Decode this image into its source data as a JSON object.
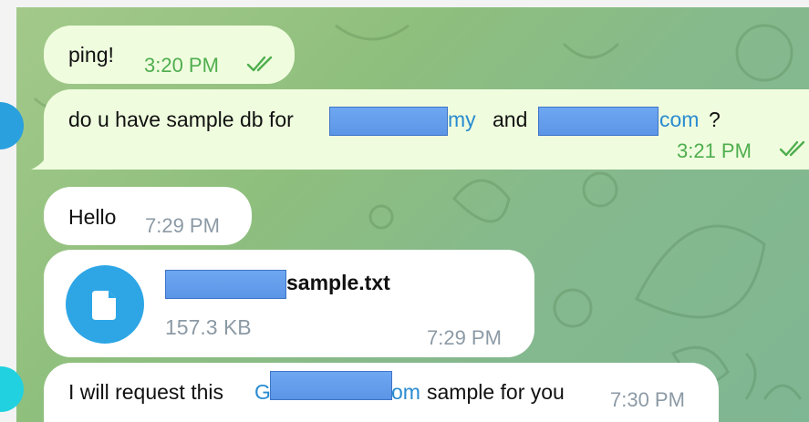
{
  "messages": [
    {
      "text": "ping!",
      "time": "3:20 PM"
    },
    {
      "text_before": "do u have sample db for",
      "link1": "my",
      "middle": "and",
      "link2": "com",
      "after": "?",
      "time": "3:21 PM"
    },
    {
      "text": "Hello",
      "time": "7:29 PM"
    },
    {
      "file_name": "sample.txt",
      "file_size": "157.3 KB",
      "time": "7:29 PM"
    },
    {
      "text_before": "I will request this",
      "link_start": "G",
      "link_end": "om",
      "after": "sample for you",
      "time": "7:30 PM"
    }
  ],
  "colors": {
    "outgoing_bubble": "#effdde",
    "incoming_bubble": "#ffffff",
    "outgoing_time": "#4fae4e",
    "link": "#2a8bd0",
    "file_icon_bg": "#2ea6e6"
  },
  "icons": [
    "double-check-icon",
    "file-icon"
  ]
}
